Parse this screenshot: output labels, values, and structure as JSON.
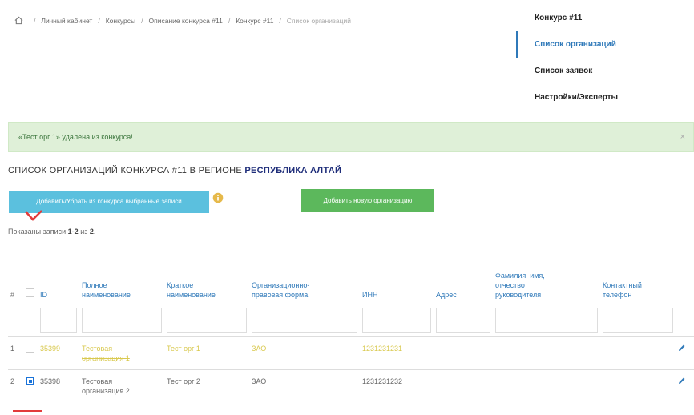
{
  "breadcrumb": {
    "items": [
      "Личный кабинет",
      "Конкурсы",
      "Описание конкурса #11",
      "Конкурс #11"
    ],
    "current": "Список организаций"
  },
  "side_menu": {
    "items": [
      {
        "label": "Конкурс #11",
        "active": false
      },
      {
        "label": "Список организаций",
        "active": true
      },
      {
        "label": "Список заявок",
        "active": false
      },
      {
        "label": "Настройки/Эксперты",
        "active": false
      }
    ]
  },
  "alert": {
    "message": "«Тест орг 1» удалена из конкурса!",
    "close": "×"
  },
  "heading": {
    "prefix": "Список организаций конкурса #11 в регионе",
    "region": "Республика Алтай"
  },
  "buttons": {
    "toggle_selected": "Добавить/Убрать из конкурса выбранные записи",
    "add_new": "Добавить новую организацию"
  },
  "summary": {
    "prefix": "Показаны записи",
    "range": "1-2",
    "middle": "из",
    "total": "2",
    "suffix": "."
  },
  "table": {
    "headers": {
      "num": "#",
      "id": "ID",
      "full_name": [
        "Полное",
        "наименование"
      ],
      "short_name": [
        "Краткое",
        "наименование"
      ],
      "legal_form": [
        "Организационно-",
        "правовая форма"
      ],
      "inn": "ИНН",
      "address": "Адрес",
      "head": [
        "Фамилия, имя,",
        "отчество",
        "руководителя"
      ],
      "phone": [
        "Контактный",
        "телефон"
      ]
    },
    "rows": [
      {
        "num": "1",
        "id": "35399",
        "full_name": [
          "Тестовая",
          "организация 1"
        ],
        "short_name": "Тест орг 1",
        "legal_form": "ЗАО",
        "inn": "1231231231"
      },
      {
        "num": "2",
        "id": "35398",
        "full_name": [
          "Тестовая",
          "организация 2"
        ],
        "short_name": "Тест орг 2",
        "legal_form": "ЗАО",
        "inn": "1231231232"
      }
    ]
  },
  "colors": {
    "accent": "#2f79b9",
    "alert_bg": "#dff0d8",
    "btn_blue": "#5bc0de",
    "btn_green": "#5cb85c",
    "deleted_text": "#d9c94f",
    "annotation_red": "#e23b3b"
  },
  "icons": {
    "home": "home-icon",
    "info": "info-icon",
    "edit": "pencil-icon",
    "close": "close-icon",
    "annotation": "red-checkmark"
  }
}
